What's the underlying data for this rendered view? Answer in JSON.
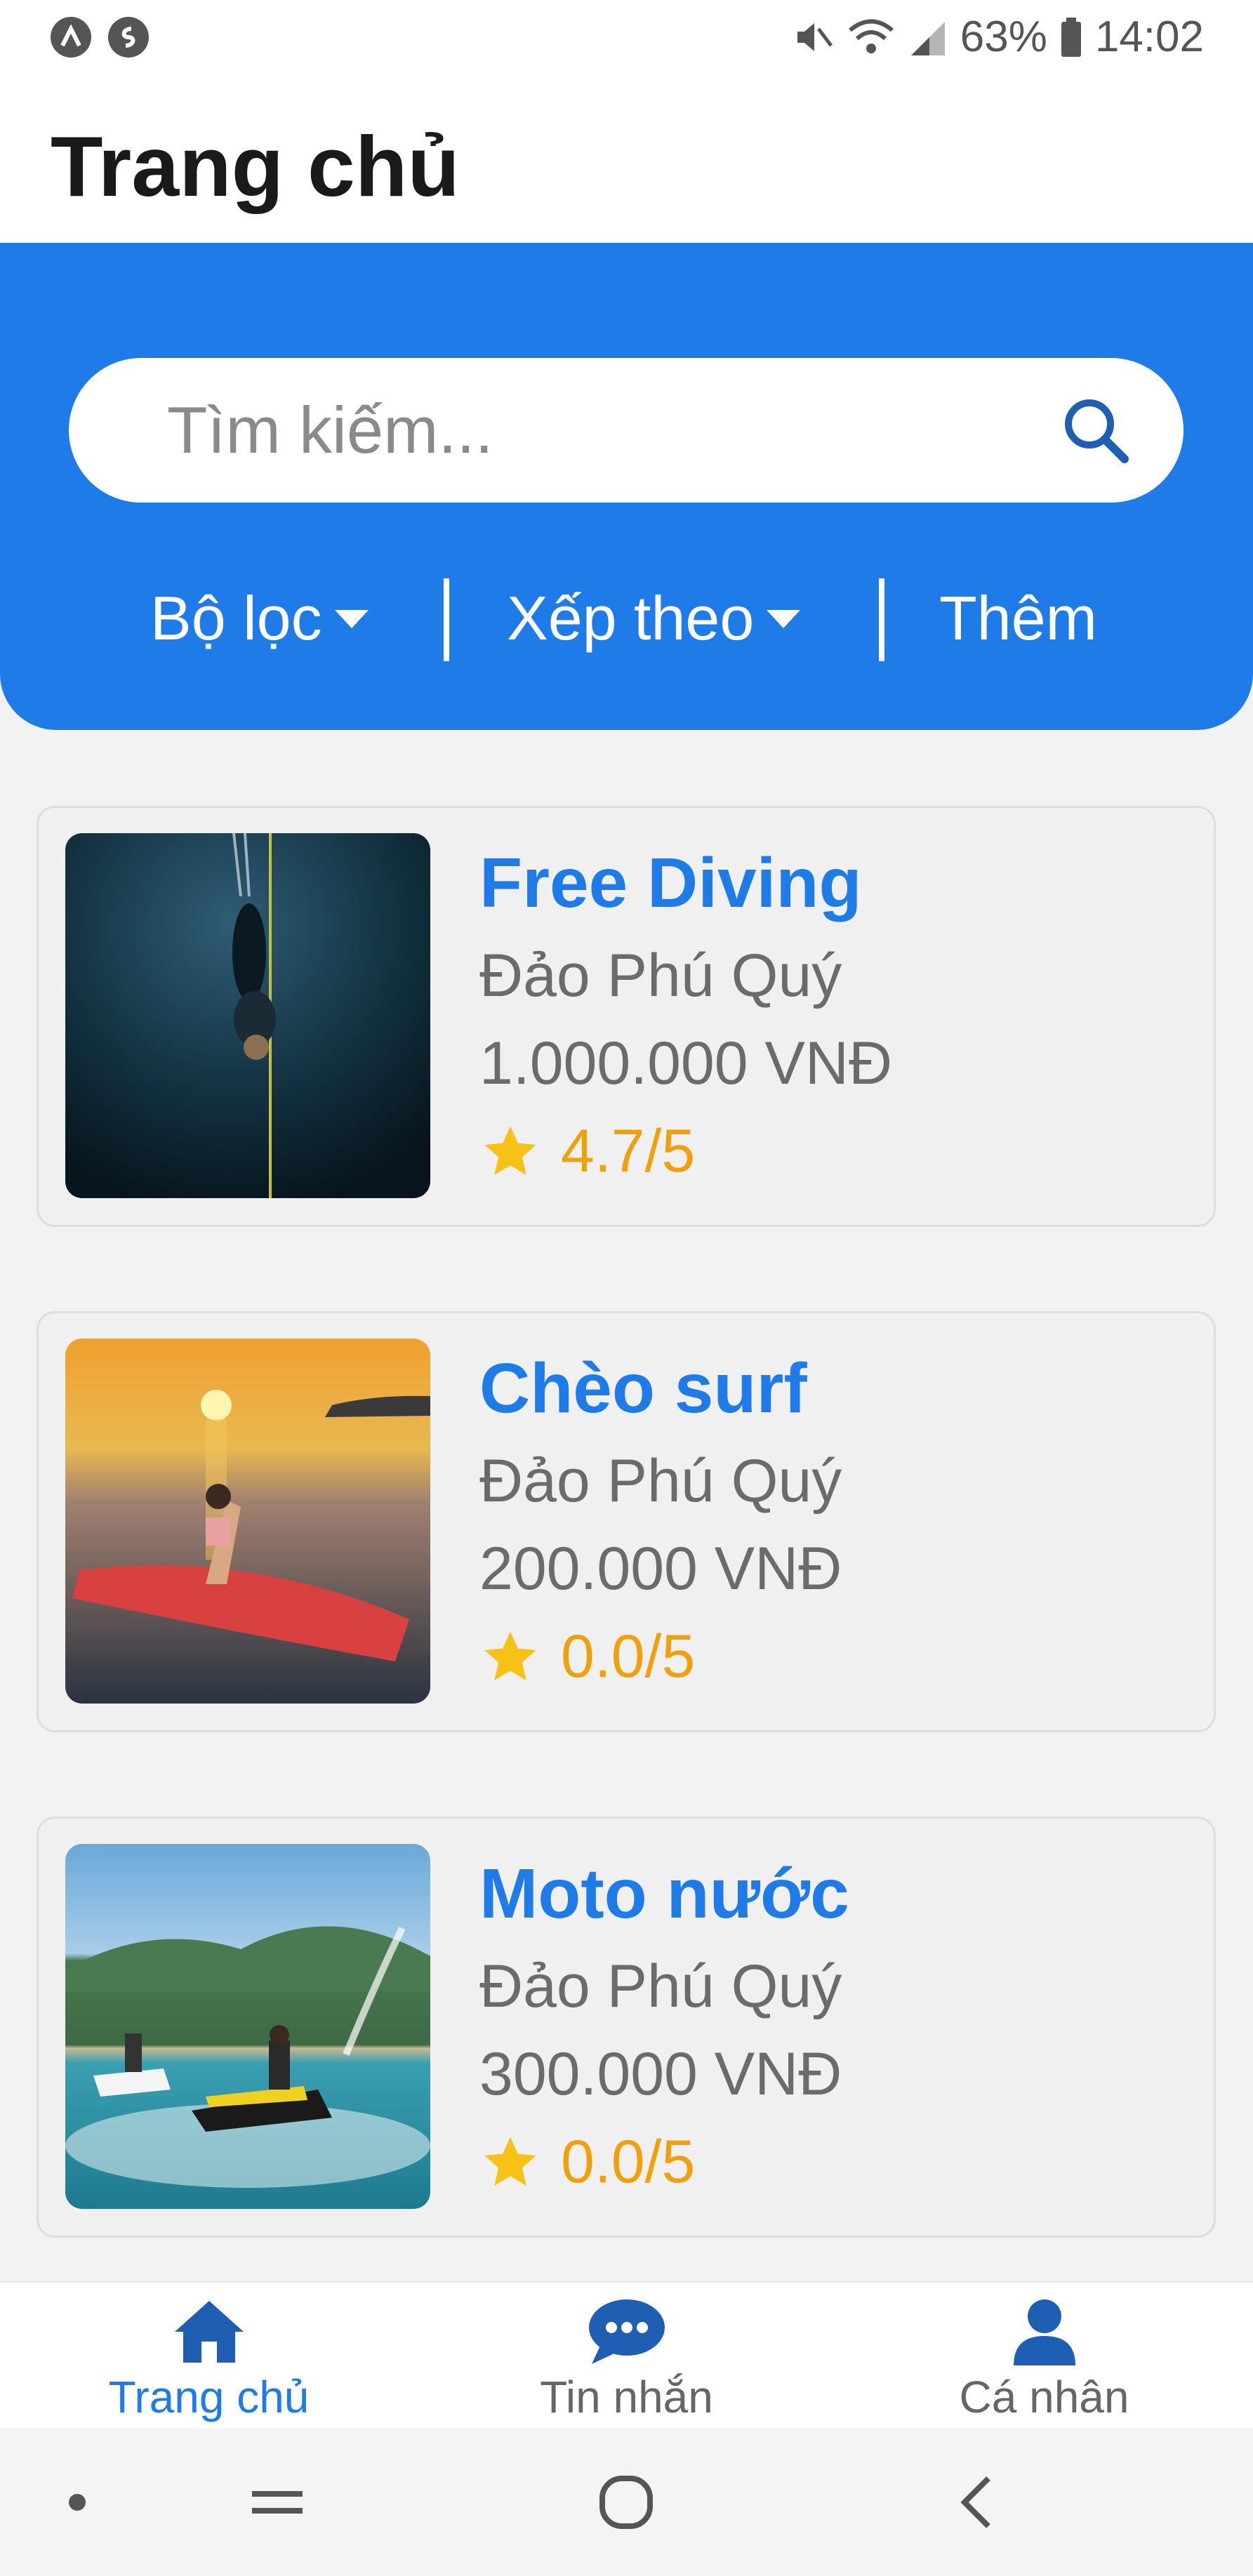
{
  "status_bar": {
    "battery": "63%",
    "time": "14:02"
  },
  "app_bar": {
    "title": "Trang chủ"
  },
  "search": {
    "placeholder": "Tìm kiếm..."
  },
  "filters": {
    "filter_label": "Bộ lọc",
    "sort_label": "Xếp theo",
    "add_label": "Thêm"
  },
  "activities": [
    {
      "title": "Free Diving",
      "location": "Đảo Phú Quý",
      "price": "1.000.000 VNĐ",
      "rating": "4.7/5",
      "image": "free-diving-photo"
    },
    {
      "title": "Chèo surf",
      "location": "Đảo Phú Quý",
      "price": "200.000 VNĐ",
      "rating": "0.0/5",
      "image": "paddle-surf-photo"
    },
    {
      "title": "Moto nước",
      "location": "Đảo Phú Quý",
      "price": "300.000 VNĐ",
      "rating": "0.0/5",
      "image": "jet-ski-photo"
    }
  ],
  "bottom_nav": {
    "home": "Trang chủ",
    "messages": "Tin nhắn",
    "profile": "Cá nhân"
  },
  "colors": {
    "primary": "#1e7be8",
    "nav_active": "#1e7be8",
    "nav_inactive": "#666666",
    "rating": "#f0a10a"
  }
}
